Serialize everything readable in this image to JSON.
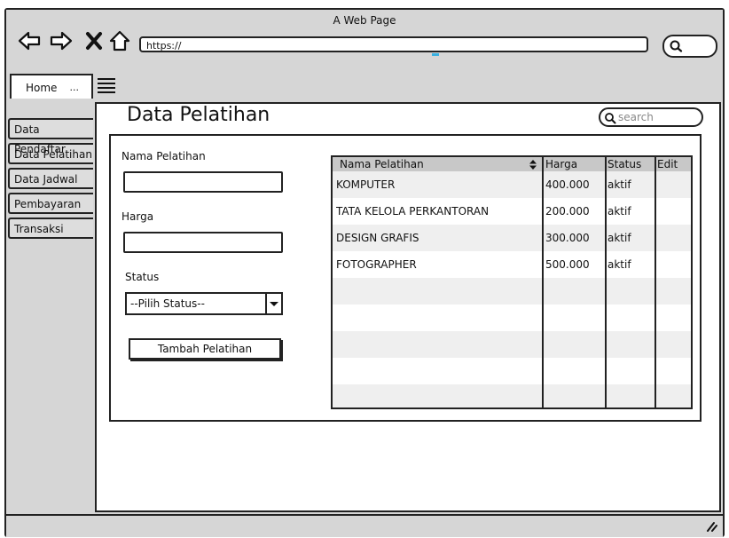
{
  "window": {
    "title": "A Web Page"
  },
  "browser": {
    "url": "https://",
    "search_pill_icon": "search-icon"
  },
  "tabs": {
    "home_label": "Home",
    "home_more": "..."
  },
  "sidebar": {
    "items": [
      {
        "label": "Data Pendaftar"
      },
      {
        "label": "Data Pelatihan"
      },
      {
        "label": "Data Jadwal"
      },
      {
        "label": "Pembayaran"
      },
      {
        "label": "Transaksi"
      }
    ]
  },
  "page": {
    "title": "Data Pelatihan",
    "search_placeholder": "search"
  },
  "form": {
    "name_label": "Nama Pelatihan",
    "name_value": "",
    "price_label": "Harga",
    "price_value": "",
    "status_label": "Status",
    "status_selected": "--Pilih Status--",
    "submit_label": "Tambah Pelatihan"
  },
  "table": {
    "headers": [
      "Nama Pelatihan",
      "Harga",
      "Status",
      "Edit"
    ],
    "rows": [
      [
        "KOMPUTER",
        "400.000",
        "aktif",
        ""
      ],
      [
        "TATA KELOLA PERKANTORAN",
        "200.000",
        "aktif",
        ""
      ],
      [
        "DESIGN GRAFIS",
        "300.000",
        "aktif",
        ""
      ],
      [
        "FOTOGRAPHER",
        "500.000",
        "aktif",
        ""
      ],
      [
        "",
        "",
        "",
        ""
      ],
      [
        "",
        "",
        "",
        ""
      ],
      [
        "",
        "",
        "",
        ""
      ],
      [
        "",
        "",
        "",
        ""
      ],
      [
        "",
        "",
        "",
        ""
      ]
    ]
  },
  "colors": {
    "chrome": "#d6d6d6",
    "header": "#c8c8c8",
    "row_alt": "#efefef",
    "cursor": "#3ab0e0"
  }
}
